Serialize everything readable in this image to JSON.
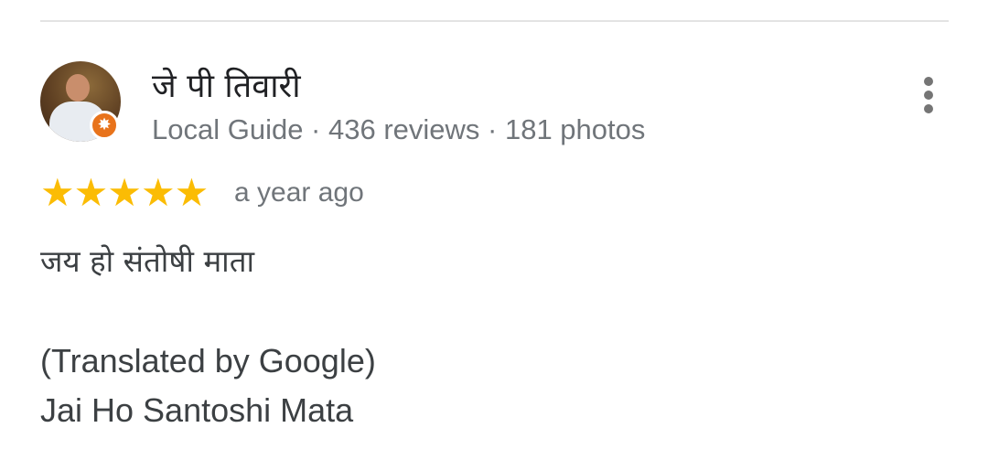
{
  "review": {
    "author": {
      "name": "जे पी तिवारी",
      "meta": "Local Guide · 436 reviews · 181 photos",
      "badge_glyph": "✸",
      "badge_color": "#e8731b"
    },
    "rating": {
      "value": 5,
      "max": 5,
      "stars": "★★★★★",
      "star_color": "#fbbc04"
    },
    "time": "a year ago",
    "original_text": "जय हो संतोषी माता",
    "translated_label": "(Translated by Google)",
    "translated_text": "Jai Ho Santoshi Mata",
    "more_icon": "more-vert-icon"
  }
}
